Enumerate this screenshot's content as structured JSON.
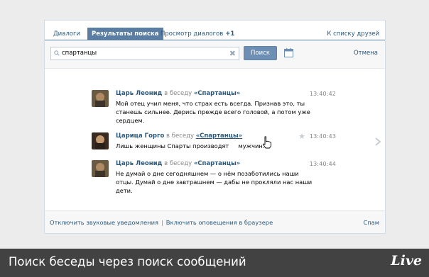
{
  "tabs": [
    {
      "label": "Диалоги"
    },
    {
      "label": "Результаты поиска"
    },
    {
      "label": "Просмотр диалогов",
      "count": "+1"
    }
  ],
  "friends_link": "К списку друзей",
  "search": {
    "value": "спартанцы",
    "button_label": "Поиск",
    "cancel_label": "Отмена"
  },
  "messages": [
    {
      "author": "Царь Леонид",
      "in_chat_prefix": "в беседу",
      "chat_name": "«Спартанцы»",
      "time": "13:40:42",
      "text": "Мой отец учил меня, что страх есть всегда. Признав это, ты станешь сильнее. Дерись прежде всего головой, а потом уже сердцем."
    },
    {
      "author": "Царица Горго",
      "in_chat_prefix": "в беседу",
      "chat_name": "«Спартанцы»",
      "time": "13:40:43",
      "text": "Лишь женщины Спарты производят     мужчин."
    },
    {
      "author": "Царь Леонид",
      "in_chat_prefix": "в беседу",
      "chat_name": "«Спартанцы»",
      "time": "13:40:44",
      "text": "Не думай о дне сегодняшнем — о нём позаботились наши отцы. Думай о дне завтрашнем — дабы не прокляли нас наши дети."
    }
  ],
  "footer": {
    "sound_link": "Отключить звуковые уведомления",
    "separator": "|",
    "browser_link": "Включить оповещения в браузере",
    "spam_link": "Спам"
  },
  "caption": "Поиск беседы через поиск сообщений",
  "logo_text": "Live",
  "colors": {
    "accent": "#597da3",
    "link": "#2b587a",
    "button": "#6d8fb3",
    "caption_bar": "#424242"
  }
}
